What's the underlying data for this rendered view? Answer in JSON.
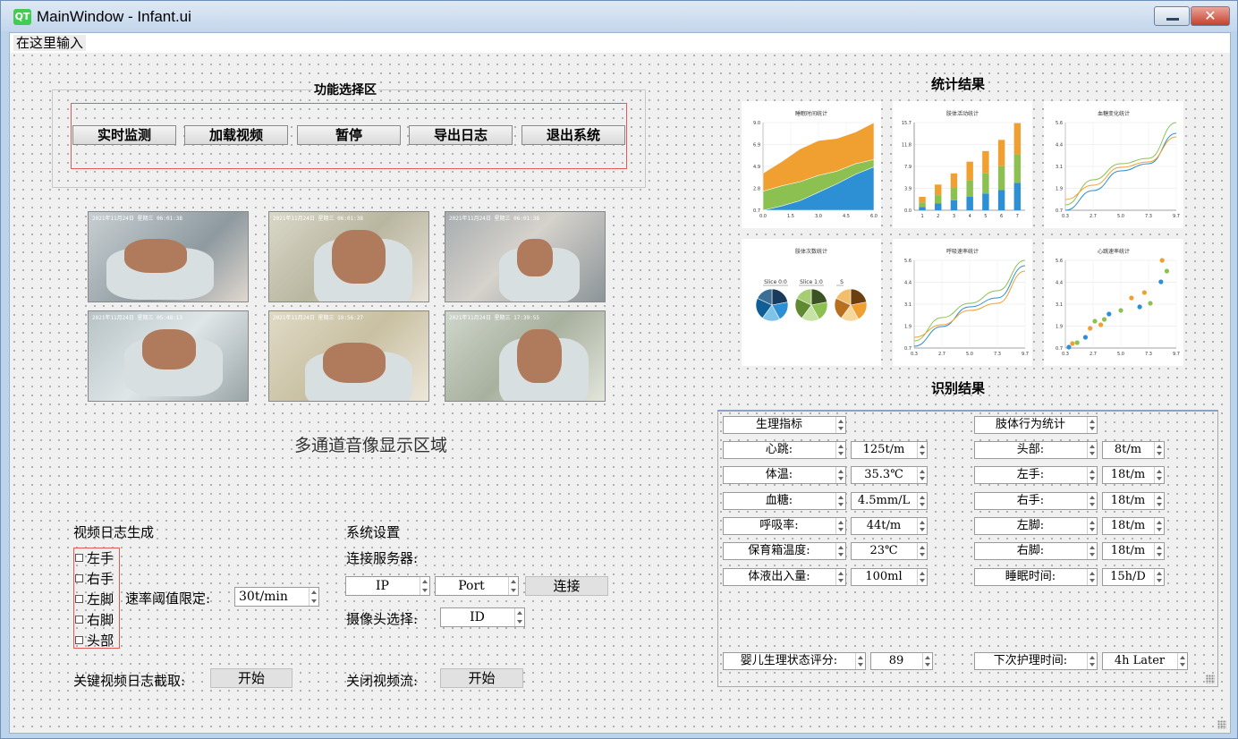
{
  "window": {
    "title": "MainWindow - Infant.ui",
    "logo": "QT"
  },
  "menu": {
    "item": "在这里输入"
  },
  "function_area": {
    "title": "功能选择区",
    "buttons": [
      "实时监测",
      "加载视频",
      "暂停",
      "导出日志",
      "退出系统"
    ]
  },
  "video_area": {
    "label": "多通道音像显示区域",
    "stamps": [
      "2021年11月24日 星期三 06:01:38",
      "2021年11月24日 星期三 06:01:38",
      "2021年11月24日 星期三 06:01:38",
      "2021年11月24日 星期三 05:48:13",
      "2021年11月24日 星期三 19:56:27",
      "2021年11月24日 星期三 17:39:55"
    ]
  },
  "log_section": {
    "title": "视频日志生成",
    "checkboxes": [
      "左手",
      "右手",
      "左脚",
      "右脚",
      "头部"
    ],
    "rate_label": "速率阈值限定:",
    "rate_value": "30t/min",
    "capture_label": "关键视频日志截取:",
    "capture_button": "开始"
  },
  "settings": {
    "title": "系统设置",
    "server_label": "连接服务器:",
    "ip": "IP",
    "port": "Port",
    "connect_button": "连接",
    "camera_label": "摄像头选择:",
    "camera_value": "ID",
    "close_stream_label": "关闭视频流:",
    "close_stream_button": "开始"
  },
  "stats": {
    "title": "统计结果"
  },
  "recognition": {
    "title": "识别结果",
    "left_header": "生理指标",
    "right_header": "肢体行为统计",
    "left_rows": [
      {
        "label": "心跳:",
        "value": "125t/m"
      },
      {
        "label": "体温:",
        "value": "35.3℃"
      },
      {
        "label": "血糖:",
        "value": "4.5mm/L"
      },
      {
        "label": "呼吸率:",
        "value": "44t/m"
      },
      {
        "label": "保育箱温度:",
        "value": "23℃"
      },
      {
        "label": "体液出入量:",
        "value": "100ml"
      }
    ],
    "right_rows": [
      {
        "label": "头部:",
        "value": "8t/m"
      },
      {
        "label": "左手:",
        "value": "18t/m"
      },
      {
        "label": "右手:",
        "value": "18t/m"
      },
      {
        "label": "左脚:",
        "value": "18t/m"
      },
      {
        "label": "右脚:",
        "value": "18t/m"
      },
      {
        "label": "睡眠时间:",
        "value": "15h/D"
      }
    ],
    "score_label": "婴儿生理状态评分:",
    "score_value": "89",
    "next_care_label": "下次护理时间:",
    "next_care_value": "4h Later"
  },
  "colors": {
    "blue": "#2d8fd4",
    "green": "#8cc152",
    "orange": "#f0a030",
    "red_border": "#e05a5a"
  },
  "chart_data": [
    {
      "type": "area",
      "title": "睡眠时间统计",
      "x": [
        0,
        1,
        2,
        3,
        4,
        5,
        6
      ],
      "yticks": [
        "0.7",
        "2.8",
        "4.9",
        "6.9",
        "9.0"
      ],
      "xticks": [
        "0.0",
        "1.5",
        "3.0",
        "4.5",
        "6.0"
      ],
      "ylim": [
        0.7,
        9.0
      ],
      "series": [
        {
          "values": [
            0.7,
            1.1,
            1.6,
            2.4,
            3.2,
            4.1,
            4.8
          ]
        },
        {
          "values": [
            2.5,
            3.0,
            3.4,
            4.0,
            4.4,
            5.1,
            5.5
          ]
        },
        {
          "values": [
            4.2,
            5.3,
            6.5,
            7.3,
            7.5,
            8.1,
            9.0
          ]
        }
      ]
    },
    {
      "type": "bar",
      "title": "肢体活动统计",
      "categories": [
        "1",
        "2",
        "3",
        "4",
        "5",
        "6",
        "7"
      ],
      "yticks": [
        "0.0",
        "3.9",
        "7.9",
        "11.8",
        "15.7"
      ],
      "ylim": [
        0,
        15.7
      ],
      "series": [
        {
          "values": [
            0.6,
            1.2,
            1.8,
            2.4,
            3.0,
            3.6,
            4.9
          ]
        },
        {
          "values": [
            0.8,
            1.5,
            2.2,
            3.0,
            3.6,
            4.3,
            5.1
          ]
        },
        {
          "values": [
            1.0,
            1.9,
            2.6,
            3.3,
            4.0,
            4.7,
            5.6
          ]
        }
      ]
    },
    {
      "type": "line",
      "title": "血糖变化统计",
      "x": [
        0.3,
        2.7,
        5.0,
        7.3,
        9.7
      ],
      "xticks": [
        "0.3",
        "2.7",
        "5.0",
        "7.3",
        "9.7"
      ],
      "yticks": [
        "0.7",
        "1.9",
        "3.1",
        "4.4",
        "5.6"
      ],
      "ylim": [
        0.7,
        5.6
      ],
      "series": [
        {
          "values": [
            0.7,
            1.8,
            2.9,
            3.3,
            5.0
          ]
        },
        {
          "values": [
            1.0,
            2.4,
            3.3,
            3.6,
            5.6
          ]
        },
        {
          "values": [
            1.3,
            2.1,
            3.1,
            3.4,
            4.8
          ]
        }
      ]
    },
    {
      "type": "pie",
      "title": "肢体次数统计",
      "labels": [
        "Slice 0:0",
        "Slice 1:0",
        "S"
      ],
      "pies": [
        {
          "colors": [
            "#1a3a5c",
            "#2d8fd4",
            "#7fc2ea",
            "#0f5f96",
            "#3d6f96"
          ],
          "values": [
            22,
            20,
            18,
            22,
            18
          ]
        },
        {
          "colors": [
            "#3b5323",
            "#8cc152",
            "#c7e2a4",
            "#5f8a32",
            "#a6cc74"
          ],
          "values": [
            22,
            20,
            18,
            22,
            18
          ]
        },
        {
          "colors": [
            "#6b3f10",
            "#f0a030",
            "#f8d79c",
            "#b8701e",
            "#f3be6c"
          ],
          "values": [
            22,
            20,
            18,
            22,
            18
          ]
        }
      ]
    },
    {
      "type": "line",
      "title": "呼吸速率统计",
      "x": [
        0.3,
        2.7,
        5.0,
        7.3,
        9.7
      ],
      "xticks": [
        "0.3",
        "2.7",
        "5.0",
        "7.3",
        "9.7"
      ],
      "yticks": [
        "0.7",
        "1.9",
        "3.1",
        "4.4",
        "5.6"
      ],
      "ylim": [
        0.7,
        5.6
      ],
      "series": [
        {
          "values": [
            0.8,
            1.9,
            3.0,
            3.5,
            5.3
          ]
        },
        {
          "values": [
            1.1,
            2.4,
            3.2,
            3.9,
            5.6
          ]
        },
        {
          "values": [
            1.3,
            2.0,
            2.8,
            3.2,
            5.0
          ]
        }
      ]
    },
    {
      "type": "scatter",
      "title": "心跳速率统计",
      "xticks": [
        "0.3",
        "2.7",
        "5.0",
        "7.3",
        "9.7"
      ],
      "yticks": [
        "0.7",
        "1.9",
        "3.1",
        "4.4",
        "5.6"
      ],
      "xlim": [
        0.3,
        9.7
      ],
      "ylim": [
        0.7,
        5.6
      ],
      "series": [
        {
          "points": [
            [
              0.6,
              0.75
            ],
            [
              2.0,
              1.3
            ],
            [
              4.0,
              2.6
            ],
            [
              6.6,
              3.0
            ],
            [
              8.4,
              4.4
            ]
          ]
        },
        {
          "points": [
            [
              1.3,
              1.0
            ],
            [
              2.8,
              2.2
            ],
            [
              3.6,
              2.3
            ],
            [
              5.0,
              2.8
            ],
            [
              7.5,
              3.2
            ],
            [
              8.9,
              5.0
            ]
          ]
        },
        {
          "points": [
            [
              0.9,
              0.95
            ],
            [
              2.4,
              1.8
            ],
            [
              3.3,
              2.0
            ],
            [
              5.9,
              3.5
            ],
            [
              7.0,
              3.8
            ],
            [
              8.5,
              5.6
            ]
          ]
        }
      ]
    }
  ]
}
